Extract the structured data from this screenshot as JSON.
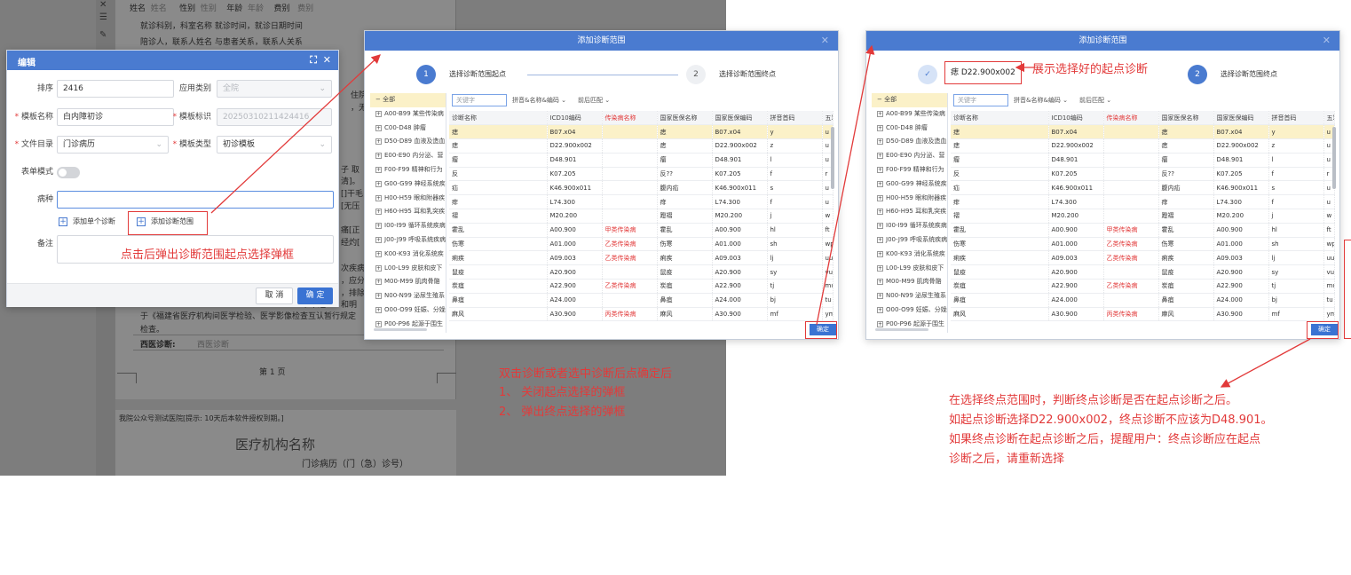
{
  "background_doc": {
    "row_patient": [
      "姓名",
      "姓名",
      "性别",
      "性别",
      "年龄",
      "年龄",
      "费别",
      "费别"
    ],
    "row_dept": "就诊科别，科室名称  就诊时间，就诊日期时间",
    "row_relation": "陪诊人，联系人姓名   与患者关系，联系人关系",
    "side_fragments": [
      "住院病",
      "，无痛"
    ],
    "mid_fragments": [
      "子 取",
      "清]。",
      "[]干毛",
      "[无压",
      "痛[正",
      "经灼[",
      "次疾病",
      "，应分",
      "，排除",
      "和明",
      "书中经"
    ],
    "consent": "于《福建省医疗机构间医学检验、医学影像检查互认暂行规定",
    "exam": "检查。",
    "western_dx_label": "西医诊断:",
    "western_dx_value": "西医诊断",
    "page_no": "第  1  页",
    "notice": "我院公众号测试医院[提示: 10天后本软件授权到期。]",
    "org_name": "医疗机构名称",
    "record_title": "门诊病历（门（急）诊号）"
  },
  "edit_dialog": {
    "title": "编辑",
    "fields": {
      "order_label": "排序",
      "order_value": "2416",
      "scope_label": "应用类别",
      "scope_value": "全院",
      "name_label": "模板名称",
      "name_value": "白内障初诊",
      "id_label": "模板标识",
      "id_value": "20250310211424416",
      "dir_label": "文件目录",
      "dir_value": "门诊病历",
      "type_label": "模板类型",
      "type_value": "初诊模板",
      "form_mode_label": "表单模式",
      "disease_label": "病种",
      "disease_value": "",
      "add_single_label": "添加单个诊断",
      "add_range_label": "添加诊断范围",
      "remark_label": "备注"
    },
    "cancel_label": "取 消",
    "confirm_label": "确 定"
  },
  "range_dialog_1": {
    "title": "添加诊断范围",
    "step1_number": "1",
    "step1_label": "选择诊断范围起点",
    "step2_number": "2",
    "step2_label": "选择诊断范围终点",
    "ok_label": "确定"
  },
  "range_dialog_2": {
    "title": "添加诊断范围",
    "chosen_start": "D22.900x002",
    "step2_number": "2",
    "step2_label": "选择诊断范围终点",
    "ok_label": "确定"
  },
  "tree": {
    "root": "全部",
    "items": [
      "A00-B99 某些传染病",
      "C00-D48 肿瘤",
      "D50-D89 血液及造血",
      "E00-E90 内分泌、营",
      "F00-F99 精神和行为",
      "G00-G99 神经系统疾",
      "H00-H59 眼和附器疾",
      "H60-H95 耳和乳突疾",
      "I00-I99 循环系统疾病",
      "J00-J99 呼吸系统疾病",
      "K00-K93 消化系统疾",
      "L00-L99 皮肤和皮下",
      "M00-M99 肌肉骨骼",
      "N00-N99 泌尿生殖系",
      "O00-O99 妊娠、分娩",
      "P00-P96 起源于围生"
    ]
  },
  "search": {
    "placeholder": "关键字",
    "mode": "拼音&名称&编码",
    "match": "前后匹配"
  },
  "table": {
    "columns": [
      "诊断名称",
      "ICD10编码",
      "传染病名称",
      "国家医保名称",
      "国家医保编码",
      "拼音首码",
      "五笔"
    ],
    "rows": [
      [
        "痣",
        "B07.x04",
        "",
        "痣",
        "B07.x04",
        "y",
        "u"
      ],
      [
        "痣",
        "D22.900x002",
        "",
        "痣",
        "D22.900x002",
        "z",
        "u"
      ],
      [
        "瘤",
        "D48.901",
        "",
        "瘤",
        "D48.901",
        "l",
        "u"
      ],
      [
        "反",
        "K07.205",
        "",
        "反??",
        "K07.205",
        "f",
        "r"
      ],
      [
        "疝",
        "K46.900x011",
        "",
        "腹内疝",
        "K46.900x011",
        "s",
        "u"
      ],
      [
        "痱",
        "L74.300",
        "",
        "痱",
        "L74.300",
        "f",
        "u"
      ],
      [
        "褶",
        "M20.200",
        "",
        "蹬褶",
        "M20.200",
        "j",
        "w"
      ],
      [
        "霍乱",
        "A00.900",
        "甲类传染病",
        "霍乱",
        "A00.900",
        "hl",
        "ft"
      ],
      [
        "伤寒",
        "A01.000",
        "乙类传染病",
        "伤寒",
        "A01.000",
        "sh",
        "wp"
      ],
      [
        "痢疾",
        "A09.003",
        "乙类传染病",
        "痢疾",
        "A09.003",
        "lj",
        "uu"
      ],
      [
        "鼠疫",
        "A20.900",
        "",
        "鼠疫",
        "A20.900",
        "sy",
        "vu"
      ],
      [
        "炭疽",
        "A22.900",
        "乙类传染病",
        "炭疽",
        "A22.900",
        "tj",
        "mu"
      ],
      [
        "鼻疽",
        "A24.000",
        "",
        "鼻疽",
        "A24.000",
        "bj",
        "tu"
      ],
      [
        "麻风",
        "A30.900",
        "丙类传染病",
        "麻风",
        "A30.900",
        "mf",
        "ym"
      ]
    ]
  },
  "annotations": {
    "click_popup": "点击后弹出诊断范围起点选择弹框",
    "show_start": "展示选择好的起点诊断",
    "after_start_title": "双击诊断或者选中诊断后点确定后",
    "after_start_1": "1、 关闭起点选择的弹框",
    "after_start_2": "2、 弹出终点选择的弹框",
    "rule_1": "在选择终点范围时，判断终点诊断是否在起点诊断之后。",
    "rule_2": "如起点诊断选择D22.900x002，终点诊断不应该为D48.901。",
    "rule_3": "如果终点诊断在起点诊断之后，提醒用户：终点诊断应在起点",
    "rule_4": "诊断之后，请重新选择"
  },
  "colors": {
    "header_blue": "#4a7bd0",
    "annotation_red": "#e23a3a",
    "selected_row": "#fbf1c8"
  }
}
